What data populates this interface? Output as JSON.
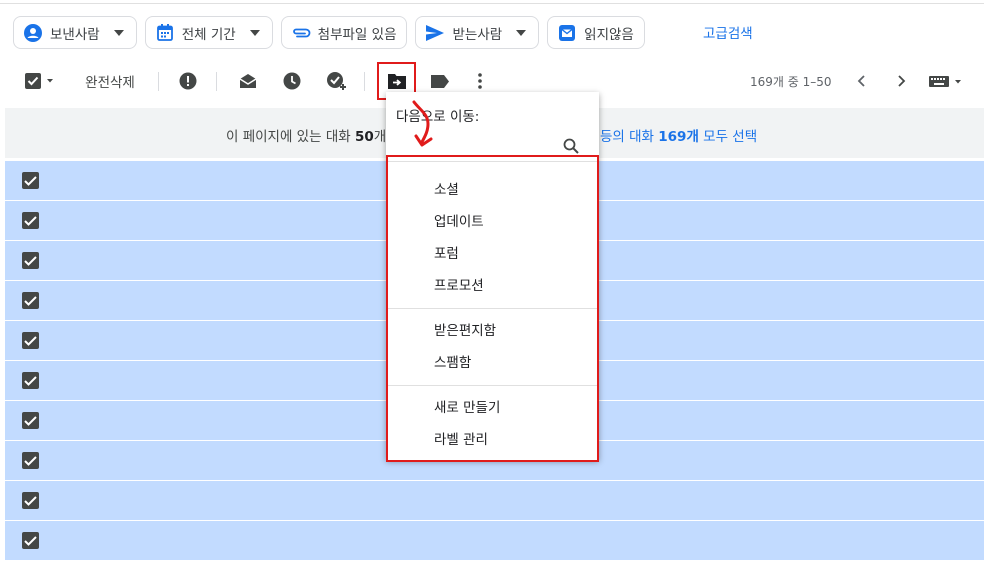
{
  "filters": {
    "sender": "보낸사람",
    "period": "전체 기간",
    "attachment": "첨부파일 있음",
    "recipient": "받는사람",
    "unread": "읽지않음",
    "advanced_search": "고급검색"
  },
  "toolbar": {
    "delete_forever": "완전삭제",
    "page_info": "169개 중 1–50"
  },
  "banner": {
    "prefix": "이 페이지에 있는 대화 ",
    "count": "50",
    "suffix": "개",
    "link_prefix": "등의 대화 ",
    "link_count": "169개",
    "link_suffix": " 모두 선택"
  },
  "move_menu": {
    "title": "다음으로 이동:",
    "items": [
      "소셜",
      "업데이트",
      "포럼",
      "프로모션"
    ],
    "folders": [
      "받은편지함",
      "스팸함"
    ],
    "actions": [
      "새로 만들기",
      "라벨 관리"
    ]
  },
  "colors": {
    "accent": "#1a73e8",
    "selected_row": "#c2dbff",
    "annotation": "#e01b1b"
  }
}
